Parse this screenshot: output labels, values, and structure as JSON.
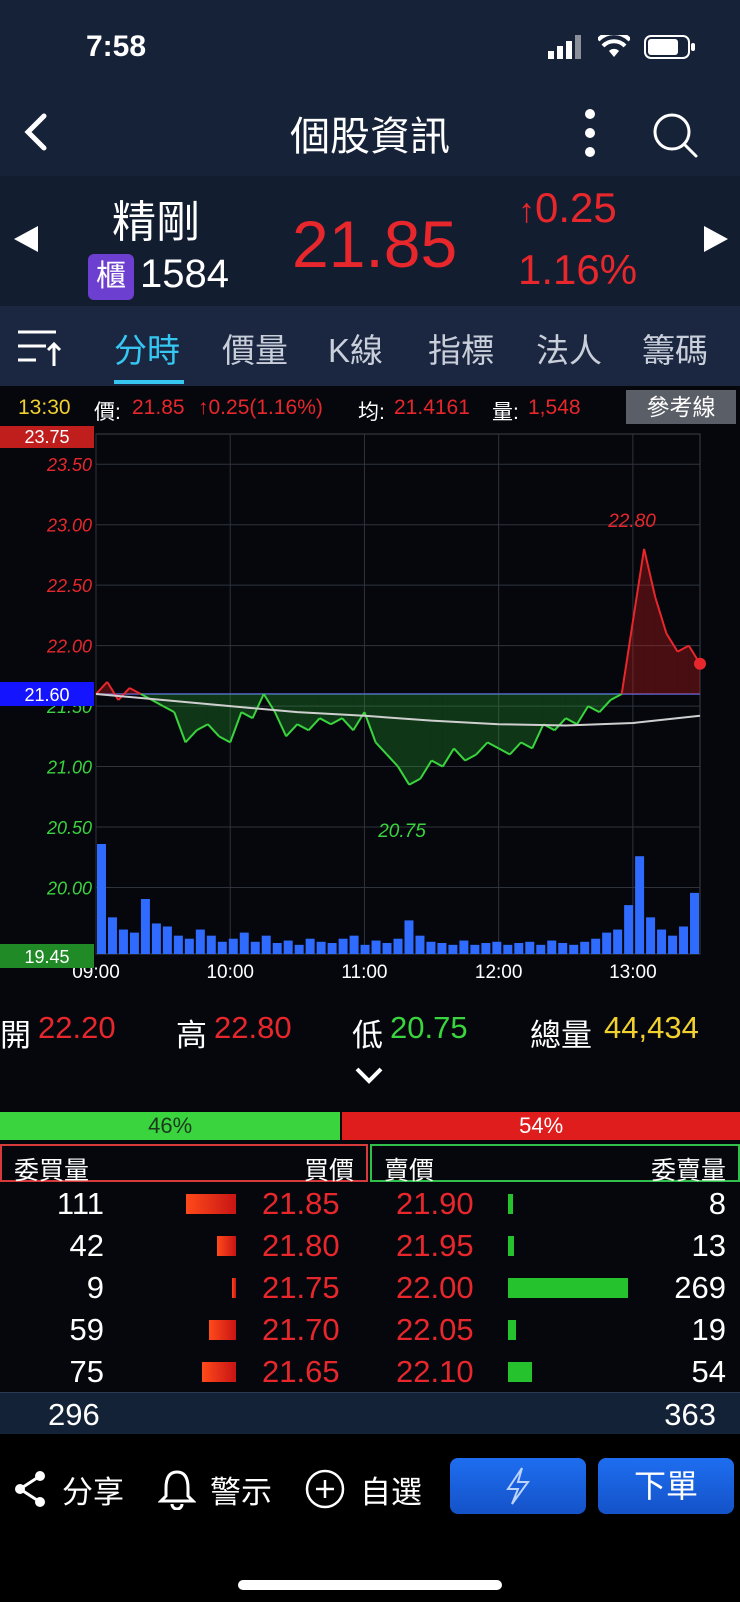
{
  "status_bar": {
    "time": "7:58"
  },
  "header": {
    "title": "個股資訊"
  },
  "quote": {
    "name": "精剛",
    "market_badge": "櫃",
    "code": "1584",
    "price": "21.85",
    "change": "0.25",
    "change_pct": "1.16%",
    "up_arrow": "↑"
  },
  "tabs": [
    {
      "label": "分時",
      "active": true
    },
    {
      "label": "價量"
    },
    {
      "label": "K線"
    },
    {
      "label": "指標"
    },
    {
      "label": "法人"
    },
    {
      "label": "籌碼"
    }
  ],
  "info_strip": {
    "time": "13:30",
    "price_label": "價:",
    "price": "21.85",
    "change": "↑0.25(1.16%)",
    "avg_label": "均:",
    "avg": "21.4161",
    "vol_label": "量:",
    "vol": "1,548",
    "ref_button": "參考線"
  },
  "chart_data": {
    "type": "line",
    "x_ticks": [
      "09:00",
      "10:00",
      "11:00",
      "12:00",
      "13:00"
    ],
    "y_ticks": [
      "23.50",
      "23.00",
      "22.50",
      "22.00",
      "21.50",
      "21.00",
      "20.50",
      "20.00"
    ],
    "ylim": [
      19.45,
      23.75
    ],
    "y_max_label": "23.75",
    "y_min_label": "19.45",
    "reference": 21.6,
    "reference_label": "21.60",
    "high_label": "22.80",
    "low_label": "20.75",
    "series": [
      {
        "x": [
          "09:00",
          "09:05",
          "09:10",
          "09:15",
          "09:20",
          "09:25",
          "09:30",
          "09:35",
          "09:40",
          "09:45",
          "09:50",
          "09:55",
          "10:00",
          "10:05",
          "10:10",
          "10:15",
          "10:20",
          "10:25",
          "10:30",
          "10:35",
          "10:40",
          "10:45",
          "10:50",
          "10:55",
          "11:00",
          "11:05",
          "11:10",
          "11:15",
          "11:20",
          "11:25",
          "11:30",
          "11:35",
          "11:40",
          "11:45",
          "11:50",
          "11:55",
          "12:00",
          "12:05",
          "12:10",
          "12:15",
          "12:20",
          "12:25",
          "12:30",
          "12:35",
          "12:40",
          "12:45",
          "12:50",
          "12:55",
          "13:00",
          "13:05",
          "13:10",
          "13:15",
          "13:20",
          "13:25",
          "13:30"
        ],
        "values": [
          21.6,
          21.7,
          21.55,
          21.65,
          21.6,
          21.55,
          21.5,
          21.45,
          21.2,
          21.3,
          21.35,
          21.25,
          21.2,
          21.45,
          21.4,
          21.6,
          21.45,
          21.25,
          21.35,
          21.3,
          21.4,
          21.35,
          21.4,
          21.3,
          21.45,
          21.2,
          21.1,
          21.0,
          20.85,
          20.9,
          21.05,
          21.0,
          21.15,
          21.05,
          21.1,
          21.2,
          21.15,
          21.1,
          21.2,
          21.15,
          21.35,
          21.3,
          21.4,
          21.35,
          21.5,
          21.45,
          21.55,
          21.6,
          22.2,
          22.8,
          22.4,
          22.1,
          21.95,
          22.0,
          21.85
        ]
      },
      {
        "x": [
          "09:00",
          "09:30",
          "10:00",
          "10:30",
          "11:00",
          "11:30",
          "12:00",
          "12:30",
          "13:00",
          "13:30"
        ],
        "values": [
          21.6,
          21.55,
          21.5,
          21.45,
          21.42,
          21.38,
          21.35,
          21.34,
          21.36,
          21.42
        ]
      }
    ],
    "volume": [
      180,
      60,
      40,
      35,
      90,
      50,
      45,
      30,
      25,
      40,
      30,
      20,
      25,
      35,
      20,
      30,
      18,
      22,
      15,
      25,
      20,
      18,
      25,
      30,
      15,
      22,
      18,
      25,
      55,
      30,
      20,
      18,
      15,
      22,
      15,
      18,
      20,
      15,
      18,
      20,
      15,
      22,
      18,
      15,
      20,
      25,
      35,
      40,
      80,
      160,
      60,
      40,
      30,
      45,
      100
    ],
    "grid": true
  },
  "ohlc": {
    "open_label": "開",
    "open": "22.20",
    "high_label": "高",
    "high": "22.80",
    "low_label": "低",
    "low": "20.75",
    "vol_label": "總量",
    "vol": "44,434"
  },
  "ratio": {
    "buy": "46%",
    "sell": "54%",
    "buy_frac": 0.46
  },
  "order_book": {
    "head": {
      "bid_vol": "委買量",
      "bid_price": "買價",
      "ask_price": "賣價",
      "ask_vol": "委賣量"
    },
    "rows": [
      {
        "bid_vol": "111",
        "bid_price": "21.85",
        "ask_price": "21.90",
        "ask_vol": "8"
      },
      {
        "bid_vol": "42",
        "bid_price": "21.80",
        "ask_price": "21.95",
        "ask_vol": "13"
      },
      {
        "bid_vol": "9",
        "bid_price": "21.75",
        "ask_price": "22.00",
        "ask_vol": "269"
      },
      {
        "bid_vol": "59",
        "bid_price": "21.70",
        "ask_price": "22.05",
        "ask_vol": "19"
      },
      {
        "bid_vol": "75",
        "bid_price": "21.65",
        "ask_price": "22.10",
        "ask_vol": "54"
      }
    ],
    "bid_total": "296",
    "ask_total": "363"
  },
  "bottom": {
    "share": "分享",
    "alert": "警示",
    "watch": "自選",
    "order": "下單"
  },
  "colors": {
    "up": "#e8272c",
    "down": "#3ad43e",
    "accent": "#35c7f2",
    "volume": "#2f6bff"
  }
}
